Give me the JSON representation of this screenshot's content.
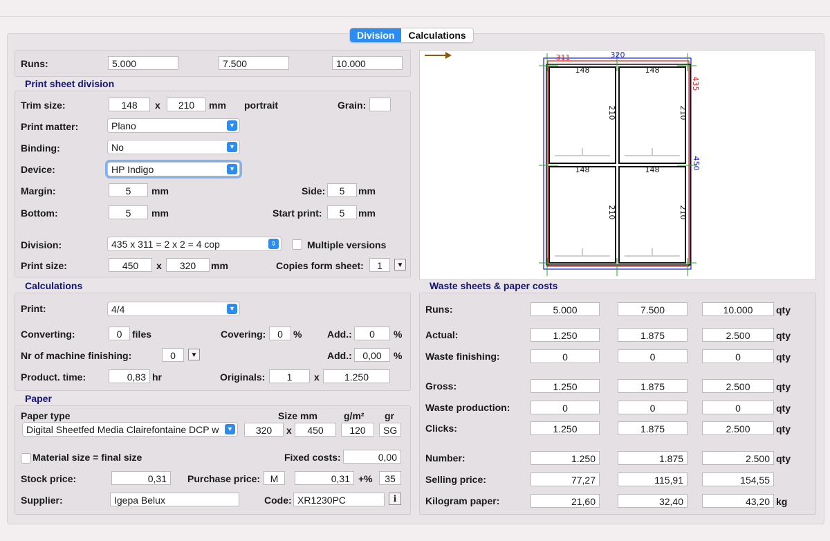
{
  "tabs": {
    "division": "Division",
    "calculations": "Calculations"
  },
  "runs": {
    "label": "Runs:",
    "values": [
      "5.000",
      "7.500",
      "10.000"
    ]
  },
  "division": {
    "title": "Print sheet division",
    "trim_label": "Trim size:",
    "trim_w": "148",
    "x1": "x",
    "trim_h": "210",
    "mm1": "mm",
    "orientation": "portrait",
    "grain_label": "Grain:",
    "grain_value": "",
    "print_matter_label": "Print matter:",
    "print_matter": "Plano",
    "binding_label": "Binding:",
    "binding": "No",
    "device_label": "Device:",
    "device": "HP Indigo",
    "margin_label": "Margin:",
    "margin": "5",
    "mm2": "mm",
    "side_label": "Side:",
    "side": "5",
    "mm3": "mm",
    "bottom_label": "Bottom:",
    "bottom": "5",
    "mm4": "mm",
    "start_label": "Start print:",
    "start": "5",
    "mm5": "mm",
    "division_label": "Division:",
    "division_value": "435 x 311 = 2 x 2 = 4 cop",
    "multiple_label": "Multiple versions",
    "print_size_label": "Print size:",
    "print_w": "450",
    "x2": "x",
    "print_h": "320",
    "mm6": "mm",
    "copies_label": "Copies form sheet:",
    "copies": "1"
  },
  "calc": {
    "title": "Calculations",
    "print_label": "Print:",
    "print_value": "4/4",
    "converting_label": "Converting:",
    "converting": "0",
    "files": "files",
    "covering_label": "Covering:",
    "covering": "0",
    "pct1": "%",
    "add1_label": "Add.:",
    "add1": "0",
    "pct2": "%",
    "machine_label": "Nr of machine finishing:",
    "machine": "0",
    "add2_label": "Add.:",
    "add2": "0,00",
    "pct3": "%",
    "time_label": "Product. time:",
    "time": "0,83",
    "hr": "hr",
    "originals_label": "Originals:",
    "originals": "1",
    "x3": "x",
    "originals_runs": "1.250"
  },
  "paper": {
    "title": "Paper",
    "type_label": "Paper type",
    "size_label": "Size",
    "mm_label": "mm",
    "gsm_label": "g/m²",
    "gr_label": "gr",
    "type": "Digital Sheetfed Media Clairefontaine DCP w",
    "size_w": "320",
    "x4": "x",
    "size_h": "450",
    "gsm": "120",
    "gr": "SG",
    "material_label": "Material size = final size",
    "fixed_label": "Fixed costs:",
    "fixed": "0,00",
    "stock_label": "Stock price:",
    "stock": "0,31",
    "purchase_label": "Purchase price:",
    "purchase_unit": "M",
    "purchase": "0,31",
    "plus_label": "+%",
    "plus": "35",
    "supplier_label": "Supplier:",
    "supplier": "Igepa Belux",
    "code_label": "Code:",
    "code": "XR1230PC",
    "info": "i"
  },
  "preview": {
    "dim_top_red": "311",
    "dim_top_blue": "320",
    "dim_right_red": "435",
    "dim_right_blue": "450",
    "cells": [
      {
        "w": "148",
        "h": "210"
      },
      {
        "w": "148",
        "h": "210"
      },
      {
        "w": "148",
        "h": "210"
      },
      {
        "w": "148",
        "h": "210"
      }
    ],
    "colors": {
      "red": "#d8201c",
      "blue": "#1a1ad8",
      "green": "#22aa22",
      "arrow": "#8a5a10"
    }
  },
  "waste": {
    "title": "Waste sheets & paper costs",
    "rows": [
      {
        "label": "Runs:",
        "v": [
          "5.000",
          "7.500",
          "10.000"
        ],
        "unit": "qty",
        "align": "c"
      },
      {
        "label": "Actual:",
        "v": [
          "1.250",
          "1.875",
          "2.500"
        ],
        "unit": "qty",
        "align": "c"
      },
      {
        "label": "Waste finishing:",
        "v": [
          "0",
          "0",
          "0"
        ],
        "unit": "qty",
        "align": "c"
      },
      {
        "label": "Gross:",
        "v": [
          "1.250",
          "1.875",
          "2.500"
        ],
        "unit": "qty",
        "align": "c"
      },
      {
        "label": "Waste production:",
        "v": [
          "0",
          "0",
          "0"
        ],
        "unit": "qty",
        "align": "c"
      },
      {
        "label": "Clicks:",
        "v": [
          "1.250",
          "1.875",
          "2.500"
        ],
        "unit": "qty",
        "align": "c"
      },
      {
        "label": "Number:",
        "v": [
          "1.250",
          "1.875",
          "2.500"
        ],
        "unit": "qty",
        "align": "r"
      },
      {
        "label": "Selling price:",
        "v": [
          "77,27",
          "115,91",
          "154,55"
        ],
        "unit": "",
        "align": "r"
      },
      {
        "label": "Kilogram paper:",
        "v": [
          "21,60",
          "32,40",
          "43,20"
        ],
        "unit": "kg",
        "align": "r"
      }
    ]
  }
}
